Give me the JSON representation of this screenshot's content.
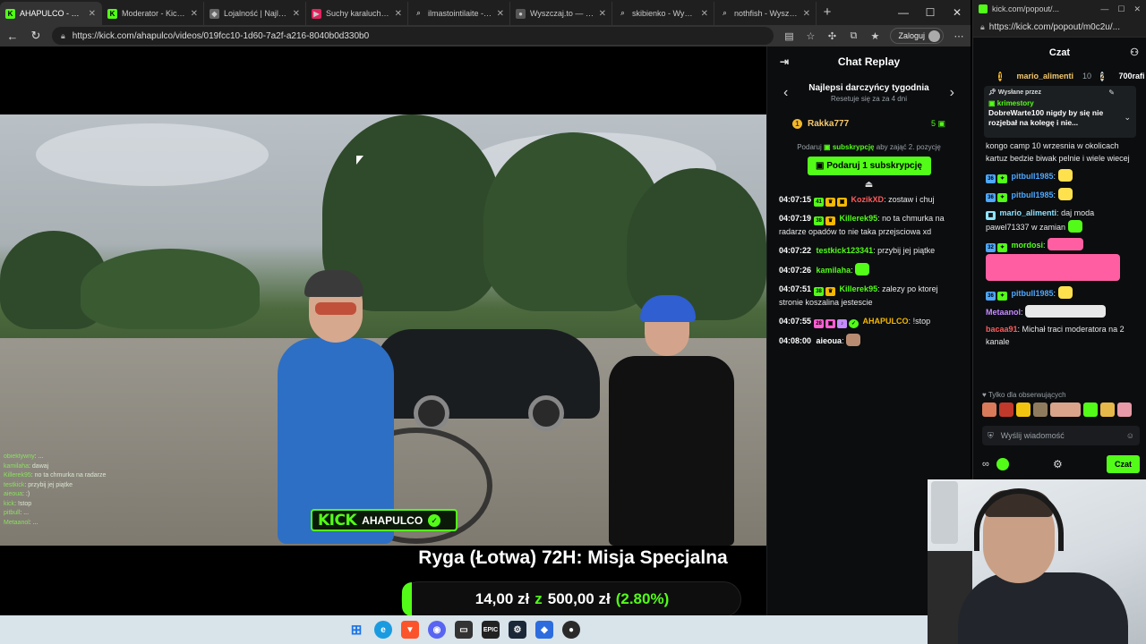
{
  "browser": {
    "tabs": [
      {
        "label": "AHAPULCO - Watch t",
        "active": true,
        "favicon": "kick-icon"
      },
      {
        "label": "Moderator - Kick Da",
        "active": false,
        "favicon": "kick-icon"
      },
      {
        "label": "Lojalność | Najlepsze",
        "active": false,
        "favicon": "shield-icon"
      },
      {
        "label": "Suchy karaluch - cyp",
        "active": false,
        "favicon": "youtube-icon"
      },
      {
        "label": "ilmastointilaite - Wys",
        "active": false,
        "favicon": "search-icon"
      },
      {
        "label": "Wyszczaj.to — znajd",
        "active": false,
        "favicon": "person-icon"
      },
      {
        "label": "skibienko - Wyszukaj",
        "active": false,
        "favicon": "search-icon"
      },
      {
        "label": "nothfish - Wyszukaj",
        "active": false,
        "favicon": "search-icon"
      }
    ],
    "url": "https://kick.com/ahapulco/videos/019fcc10-1d60-7a2f-a216-8040b0d330b0",
    "login_label": "Zaloguj"
  },
  "video": {
    "watermark_brand": "KICK",
    "watermark_user": "AHAPULCO",
    "overlay_chat": [
      {
        "user": "obiektywny",
        "text": "..."
      },
      {
        "user": "kamilaha",
        "text": "dawaj"
      },
      {
        "user": "Killerek95",
        "text": "no ta chmurka na radarze"
      },
      {
        "user": "testkick",
        "text": "przybij jej piątke"
      },
      {
        "user": "aieoua",
        "text": ":)"
      },
      {
        "user": "kick",
        "text": "!stop"
      },
      {
        "user": "pitbull",
        "text": "..."
      },
      {
        "user": "Metaanol",
        "text": "..."
      }
    ],
    "goal_title": "Ryga (Łotwa) 72H: Misja Specjalna",
    "goal_current": "14,00 zł",
    "goal_sep": "z",
    "goal_target": "500,00 zł",
    "goal_percent": "(2.80%)",
    "goal_fraction": 0.028
  },
  "replay": {
    "title": "Chat Replay",
    "leaderboard_title": "Najlepsi darczyńcy tygodnia",
    "leaderboard_reset": "Resetuje się za za 4 dni",
    "top_donor": {
      "name": "Rakka777",
      "count": "5"
    },
    "gift_hint_prefix": "Podaruj",
    "gift_hint_sub": "subskrypcję",
    "gift_hint_suffix": "aby zająć 2. pozycję",
    "gift_button": "Podaruj 1 subskrypcję",
    "messages": [
      {
        "ts": "04:07:15",
        "user": "KozikXD",
        "color": "#ff5c5c",
        "text": "zostaw i chuj",
        "badge": "41"
      },
      {
        "ts": "04:07:19",
        "user": "Killerek95",
        "color": "#53fc18",
        "text": "no ta chmurka na radarze opadów to nie taka przejsciowa xd",
        "badge": "38"
      },
      {
        "ts": "04:07:22",
        "user": "testkick123341",
        "color": "#53fc18",
        "text": "przybij jej piątke",
        "badge": ""
      },
      {
        "ts": "04:07:26",
        "user": "kamilaha",
        "color": "#53fc18",
        "text": "",
        "badge": ""
      },
      {
        "ts": "04:07:51",
        "user": "Killerek95",
        "color": "#53fc18",
        "text": "zalezy po ktorej stronie koszalina jestescie",
        "badge": "38"
      },
      {
        "ts": "04:07:55",
        "user": "AHAPULCO",
        "color": "#f5b800",
        "text": "!stop",
        "badge": "28"
      },
      {
        "ts": "04:08:00",
        "user": "aieoua",
        "color": "#ffffff",
        "text": "",
        "badge": ""
      }
    ]
  },
  "popout": {
    "window_title": "kick.com/popout/...",
    "url": "https://kick.com/popout/m0c2u/...",
    "title": "Czat",
    "leaders": [
      {
        "name": "mario_alimenti",
        "value": "10"
      },
      {
        "name": "700rafi",
        "value": ""
      }
    ],
    "pinned": {
      "header": "Wysłane przez",
      "user": "krimestory",
      "text": "DobreWarte100 nigdy by się nie rozjebał na kolegę i nie..."
    },
    "messages": [
      {
        "user": "",
        "color": "#ffffff",
        "text": "kongo camp 10 wrzesnia w okolicach kartuz bedzie biwak pelnie i wiele wiecej"
      },
      {
        "user": "pitbull1985",
        "color": "#4ea8ff",
        "text": ""
      },
      {
        "user": "pitbull1985",
        "color": "#4ea8ff",
        "text": ""
      },
      {
        "user": "mario_alimenti",
        "color": "#8fe3ff",
        "text": "daj moda pawel71337 w zamian"
      },
      {
        "user": "mordosi",
        "color": "#53fc18",
        "text": ""
      },
      {
        "user": "pitbull1985",
        "color": "#4ea8ff",
        "text": ""
      },
      {
        "user": "Metaanol",
        "color": "#c58bff",
        "text": ""
      },
      {
        "user": "bacaa91",
        "color": "#ff5c5c",
        "text": "Michał traci moderatora na 2 kanale"
      }
    ],
    "followers_only": "Tylko dla obserwujących",
    "input_placeholder": "Wyślij wiadomość",
    "send_label": "Czat"
  },
  "colors": {
    "kick_green": "#53fc18",
    "donor_gold": "#f6c96d"
  }
}
